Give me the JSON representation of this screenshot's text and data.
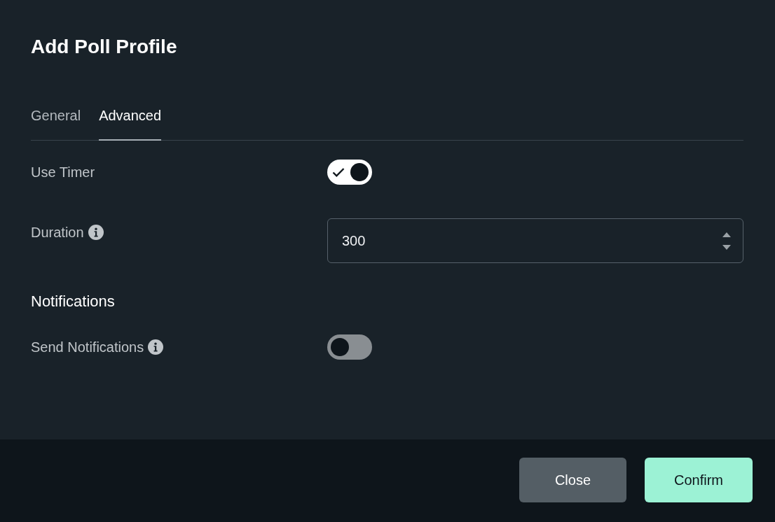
{
  "dialog": {
    "title": "Add Poll Profile"
  },
  "tabs": [
    {
      "label": "General",
      "selected": false
    },
    {
      "label": "Advanced",
      "selected": true
    }
  ],
  "fields": [
    {
      "kind": "toggle",
      "label": "Use Timer",
      "on": true,
      "info": false
    },
    {
      "kind": "number",
      "label": "Duration",
      "value": "300",
      "info": true
    }
  ],
  "notifications": {
    "heading": "Notifications",
    "fields": [
      {
        "kind": "toggle",
        "label": "Send Notifications",
        "on": false,
        "info": true
      }
    ]
  },
  "buttons": [
    {
      "label": "Close",
      "kind": "secondary"
    },
    {
      "label": "Confirm",
      "kind": "primary"
    }
  ]
}
